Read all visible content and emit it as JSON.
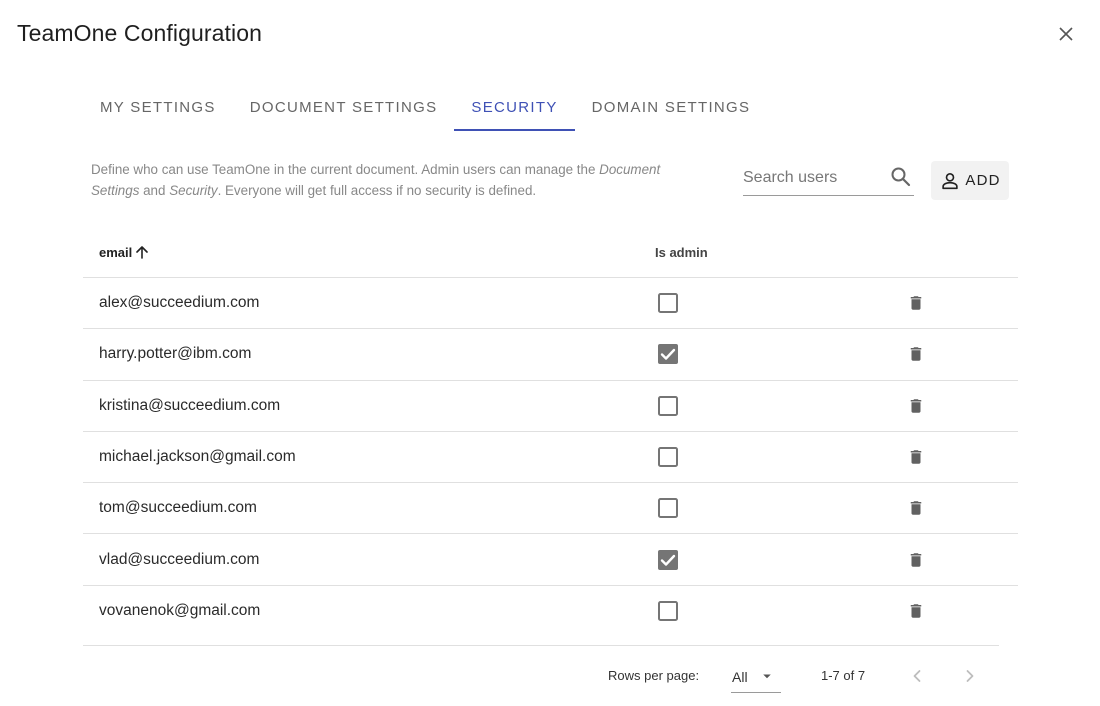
{
  "dialog": {
    "title": "TeamOne Configuration"
  },
  "tabs": [
    {
      "label": "MY SETTINGS",
      "active": false
    },
    {
      "label": "DOCUMENT SETTINGS",
      "active": false
    },
    {
      "label": "SECURITY",
      "active": true
    },
    {
      "label": "DOMAIN SETTINGS",
      "active": false
    }
  ],
  "security": {
    "description_part1": "Define who can use TeamOne in the current document. Admin users can manage the ",
    "description_em1": "Document Settings",
    "description_part2": " and ",
    "description_em2": "Security",
    "description_part3": ". Everyone will get full access if no security is defined.",
    "search_placeholder": "Search users",
    "search_value": "",
    "add_label": "ADD"
  },
  "table": {
    "columns": {
      "email": "email",
      "is_admin": "Is admin"
    },
    "sort": {
      "column": "email",
      "direction": "asc"
    },
    "rows": [
      {
        "email": "alex@succeedium.com",
        "is_admin": false
      },
      {
        "email": "harry.potter@ibm.com",
        "is_admin": true
      },
      {
        "email": "kristina@succeedium.com",
        "is_admin": false
      },
      {
        "email": "michael.jackson@gmail.com",
        "is_admin": false
      },
      {
        "email": "tom@succeedium.com",
        "is_admin": false
      },
      {
        "email": "vlad@succeedium.com",
        "is_admin": true
      },
      {
        "email": "vovanenok@gmail.com",
        "is_admin": false
      }
    ]
  },
  "pagination": {
    "rows_per_page_label": "Rows per page:",
    "rows_per_page_value": "All",
    "range": "1-7 of 7"
  },
  "icons": {
    "close": "close-icon",
    "search": "search-icon",
    "add_user": "person-outline-icon",
    "sort": "arrow-up-icon",
    "delete": "trash-icon",
    "checked": "checkbox-checked-icon",
    "unchecked": "checkbox-unchecked-icon",
    "dropdown": "caret-down-icon",
    "prev": "chevron-left-icon",
    "next": "chevron-right-icon"
  },
  "colors": {
    "accent": "#3f51b5",
    "checkbox": "#757575",
    "divider": "#e0e0e0"
  }
}
